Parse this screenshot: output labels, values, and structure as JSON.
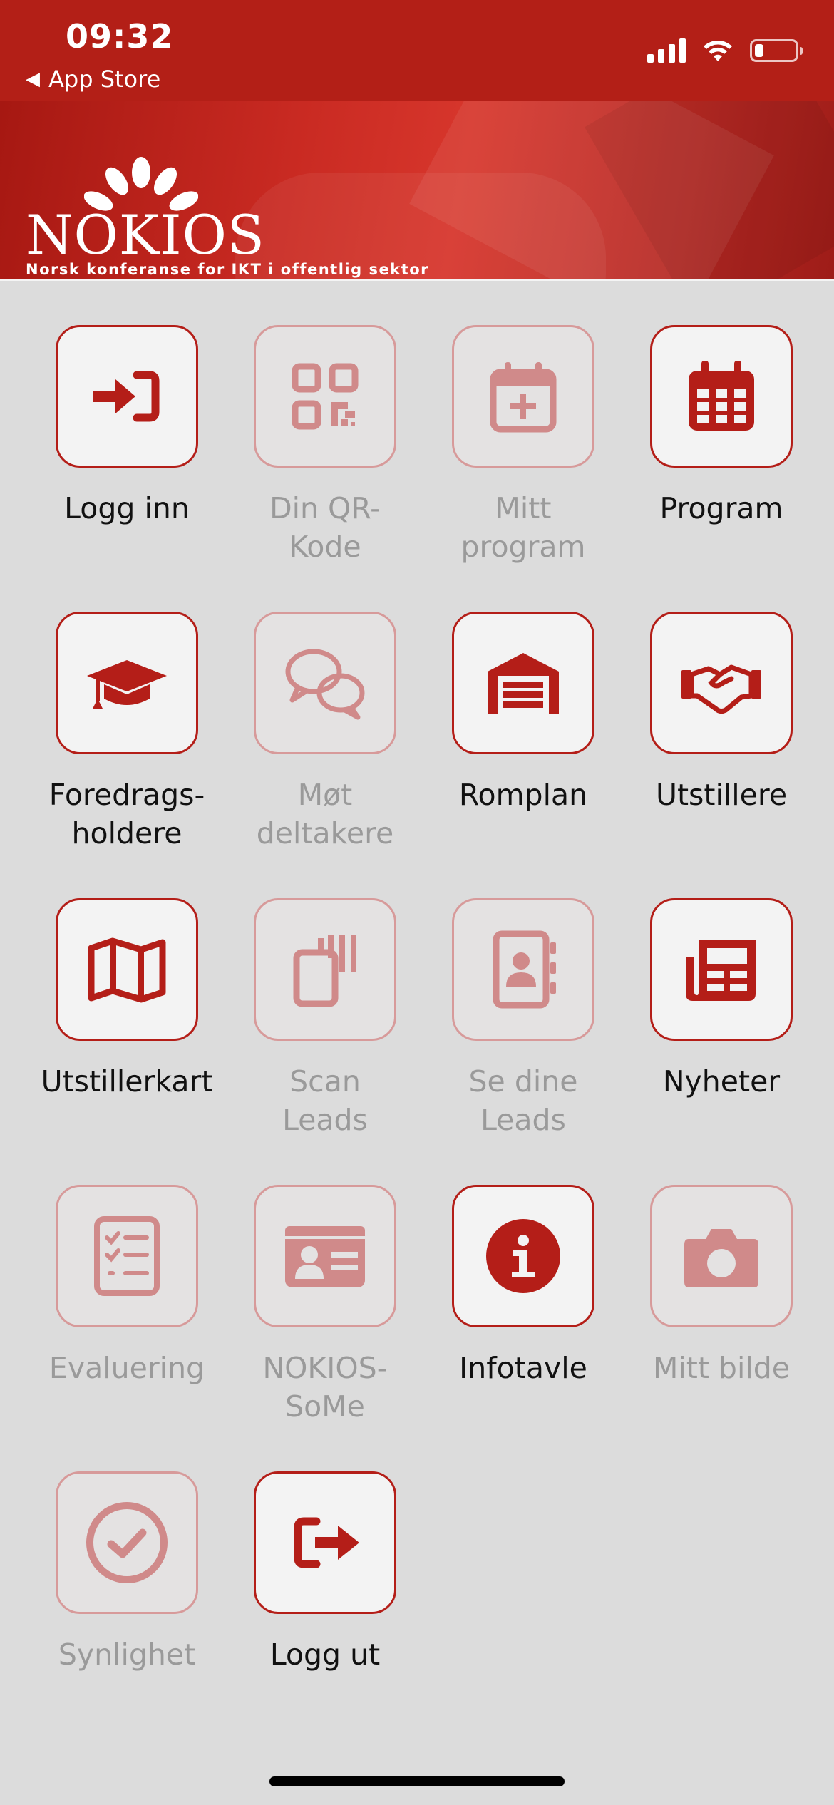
{
  "status_bar": {
    "time": "09:32",
    "back_label": "App Store",
    "icons": [
      "signal-icon",
      "wifi-icon",
      "battery-icon"
    ]
  },
  "banner": {
    "logo_text": "NOKIOS",
    "subtitle": "Norsk konferanse for IKT i offentlig sektor"
  },
  "colors": {
    "primary": "#b31f17",
    "tile_border": "#b41e18",
    "tile_border_disabled": "#d79a9a",
    "background": "#dcdcdc"
  },
  "tiles": [
    {
      "label": "Logg inn",
      "icon": "login-icon",
      "enabled": true
    },
    {
      "label": "Din QR-\nKode",
      "icon": "qr-code-icon",
      "enabled": false
    },
    {
      "label": "Mitt\nprogram",
      "icon": "calendar-plus-icon",
      "enabled": false
    },
    {
      "label": "Program",
      "icon": "calendar-icon",
      "enabled": true
    },
    {
      "label": "Foredrags-\nholdere",
      "icon": "graduation-cap-icon",
      "enabled": true
    },
    {
      "label": "Møt\ndeltakere",
      "icon": "chat-bubbles-icon",
      "enabled": false
    },
    {
      "label": "Romplan",
      "icon": "warehouse-icon",
      "enabled": true
    },
    {
      "label": "Utstillere",
      "icon": "handshake-icon",
      "enabled": true
    },
    {
      "label": "Utstillerkart",
      "icon": "map-icon",
      "enabled": true
    },
    {
      "label": "Scan\nLeads",
      "icon": "scanner-icon",
      "enabled": false
    },
    {
      "label": "Se dine\nLeads",
      "icon": "address-book-icon",
      "enabled": false
    },
    {
      "label": "Nyheter",
      "icon": "newspaper-icon",
      "enabled": true
    },
    {
      "label": "Evaluering",
      "icon": "checklist-icon",
      "enabled": false
    },
    {
      "label": "NOKIOS-\nSoMe",
      "icon": "id-card-icon",
      "enabled": false
    },
    {
      "label": "Infotavle",
      "icon": "info-icon",
      "enabled": true
    },
    {
      "label": "Mitt bilde",
      "icon": "camera-icon",
      "enabled": false
    },
    {
      "label": "Synlighet",
      "icon": "check-circle-icon",
      "enabled": false
    },
    {
      "label": "Logg ut",
      "icon": "logout-icon",
      "enabled": true
    }
  ]
}
